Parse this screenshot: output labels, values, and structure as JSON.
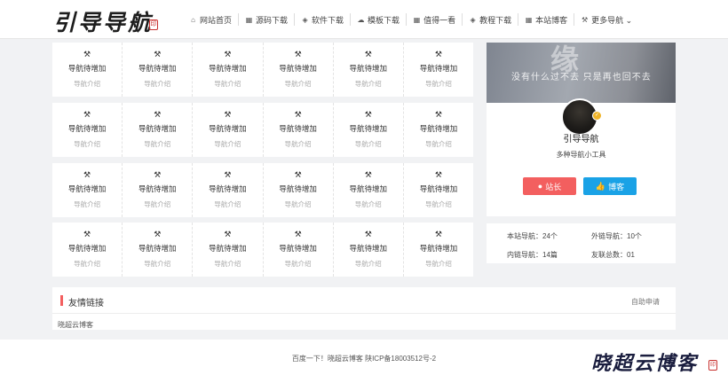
{
  "header": {
    "logo_text": "引导导航",
    "nav": [
      {
        "icon": "home-icon",
        "glyph": "⌂",
        "label": "网站首页"
      },
      {
        "icon": "windows-icon",
        "glyph": "▦",
        "label": "源码下载"
      },
      {
        "icon": "cube-icon",
        "glyph": "◈",
        "label": "软件下载"
      },
      {
        "icon": "cloud-icon",
        "glyph": "☁",
        "label": "模板下载"
      },
      {
        "icon": "windows-icon",
        "glyph": "▦",
        "label": "值得一看"
      },
      {
        "icon": "cube-icon",
        "glyph": "◈",
        "label": "教程下载"
      },
      {
        "icon": "windows-icon",
        "glyph": "▦",
        "label": "本站博客"
      },
      {
        "icon": "wrench-icon",
        "glyph": "⚒",
        "label": "更多导航 ⌄"
      }
    ]
  },
  "nav_cell": {
    "title": "导航待增加",
    "desc": "导航介绍"
  },
  "profile": {
    "banner_line": "没有什么过不去 只是再也回不去",
    "name": "引导导航",
    "desc": "多种导航小工具",
    "owner_button": "站长",
    "blog_button": "博客",
    "accent_red": "#f35f5f",
    "accent_blue": "#1aa2e6"
  },
  "stats": {
    "site_nav": "本站导航：24个",
    "external_nav": "外链导航：10个",
    "internal_nav": "内链导航：14篇",
    "friend_total": "友联总数：01"
  },
  "friends": {
    "title": "友情链接",
    "apply": "自助申请",
    "links": [
      "晓超云博客"
    ]
  },
  "footer": {
    "text": "百度一下！晓超云博客    陕ICP备18003512号-2"
  },
  "watermark": "晓超云博客"
}
